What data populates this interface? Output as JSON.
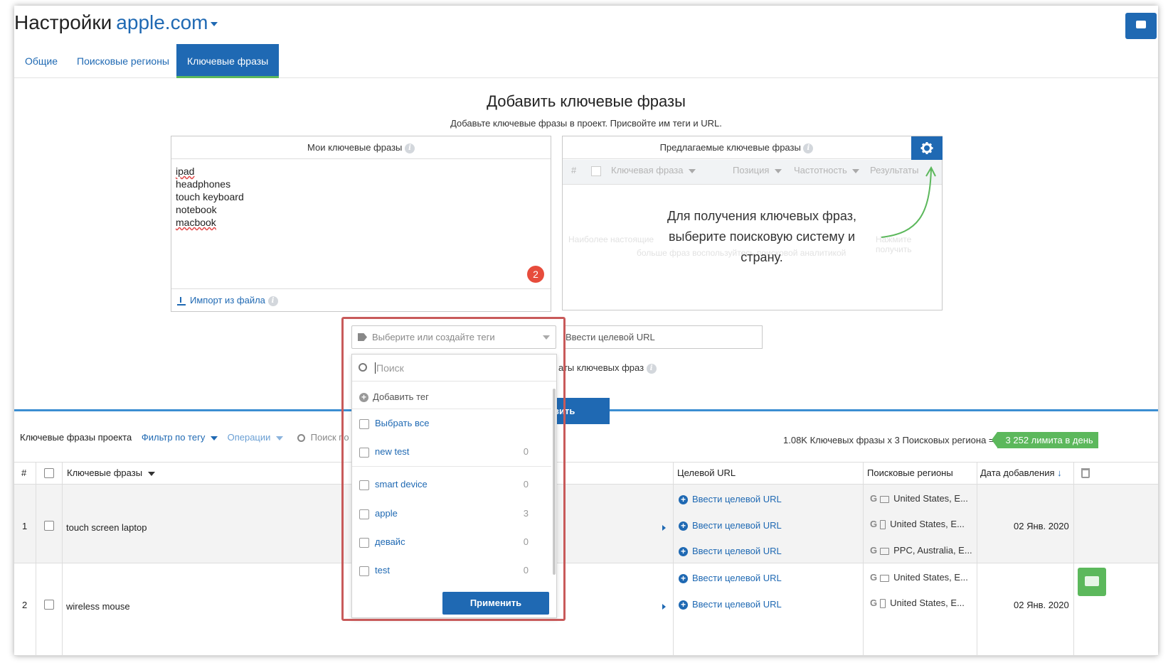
{
  "header": {
    "title": "Настройки",
    "domain": "apple.com"
  },
  "tabs": [
    {
      "label": "Общие"
    },
    {
      "label": "Поисковые регионы"
    },
    {
      "label": "Ключевые фразы"
    }
  ],
  "add_section": {
    "heading": "Добавить ключевые фразы",
    "subtitle": "Добавьте ключевые фразы в проект. Присвойте им теги и URL."
  },
  "my_keywords": {
    "title": "Мои ключевые фразы",
    "items": [
      "ipad",
      "headphones",
      "touch keyboard",
      "notebook",
      "macbook"
    ],
    "badge": "2",
    "import_label": "Импорт из файла"
  },
  "suggested": {
    "title": "Предлагаемые ключевые фразы",
    "columns": [
      "#",
      "Ключевая фраза",
      "Позиция",
      "Частотность",
      "Результаты"
    ],
    "faint_text_1": "Наиболее настоящие",
    "faint_text_2": "Нажмите получить",
    "faint_text_3": "больше фраз воспользуйтесь поисковой аналитикой",
    "tip": "Для получения ключевых фраз, выберите поисковую систему и страну."
  },
  "tags_select": {
    "placeholder": "Выберите или создайте теги"
  },
  "url_input": {
    "placeholder": "Ввести целевой URL"
  },
  "duplicates_label": "аты ключевых фраз",
  "add_button": "вить",
  "toolbar": {
    "title": "Ключевые фразы проекта",
    "filter": "Фильтр по тегу",
    "operations": "Операции",
    "search": "Поиск по"
  },
  "limits": {
    "text": "1.08K Ключевых фразы x 3 Поисковых региона =",
    "badge": "3 252 лимита в день"
  },
  "table": {
    "headers": {
      "num": "#",
      "keyword": "Ключевые фразы",
      "url": "Целевой URL",
      "regions": "Поисковые регионы",
      "date": "Дата добавления"
    },
    "rows": [
      {
        "num": "1",
        "keyword": "touch screen laptop",
        "urls": [
          "Ввести целевой URL",
          "Ввести целевой URL",
          "Ввести целевой URL"
        ],
        "regions": [
          "United States, E...",
          "United States, E...",
          "PPC, Australia, E..."
        ],
        "date": "02 Янв. 2020"
      },
      {
        "num": "2",
        "keyword": "wireless mouse",
        "urls": [
          "Ввести целевой URL",
          "Ввести целевой URL"
        ],
        "regions": [
          "United States, E...",
          "United States, E..."
        ],
        "date": "02 Янв. 2020"
      }
    ]
  },
  "tags_dropdown": {
    "search_placeholder": "Поиск",
    "add_tag": "Добавить тег",
    "select_all": "Выбрать все",
    "items": [
      {
        "label": "new test",
        "count": "0"
      },
      {
        "label": "smart device",
        "count": "0"
      },
      {
        "label": "apple",
        "count": "3"
      },
      {
        "label": "девайс",
        "count": "0"
      },
      {
        "label": "test",
        "count": "0"
      }
    ],
    "apply": "Применить"
  }
}
